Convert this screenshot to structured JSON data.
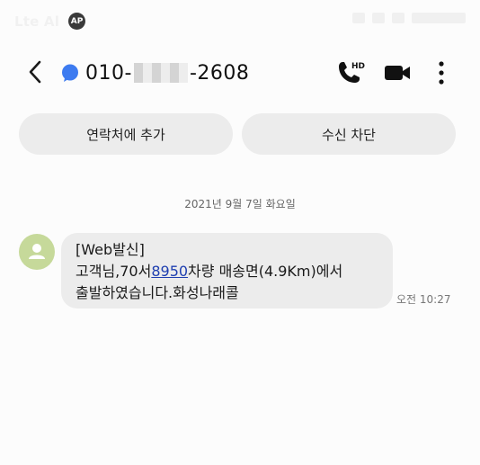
{
  "status_bar": {
    "time": "Lte Al",
    "app_badge": "AP"
  },
  "header": {
    "number_prefix": "010-",
    "number_suffix": "-2608"
  },
  "actions": {
    "add_contact": "연락처에 추가",
    "block": "수신 차단"
  },
  "conversation": {
    "date": "2021년 9월 7일 화요일",
    "message": {
      "line1": "[Web발신]",
      "line2_before": "고객님,70서",
      "line2_link": "8950",
      "line2_after": "차량 매송면(4.9Km)에서",
      "line3": "출발하였습니다.화성나래콜",
      "time": "오전 10:27"
    }
  },
  "colors": {
    "accent": "#3d7bf0",
    "bubble": "#ececec",
    "avatar": "#c6d99a",
    "link": "#1f3fb0"
  },
  "icons": [
    "back-icon",
    "chat-dot-icon",
    "call-hd-icon",
    "video-icon",
    "more-vert-icon",
    "person-icon"
  ]
}
